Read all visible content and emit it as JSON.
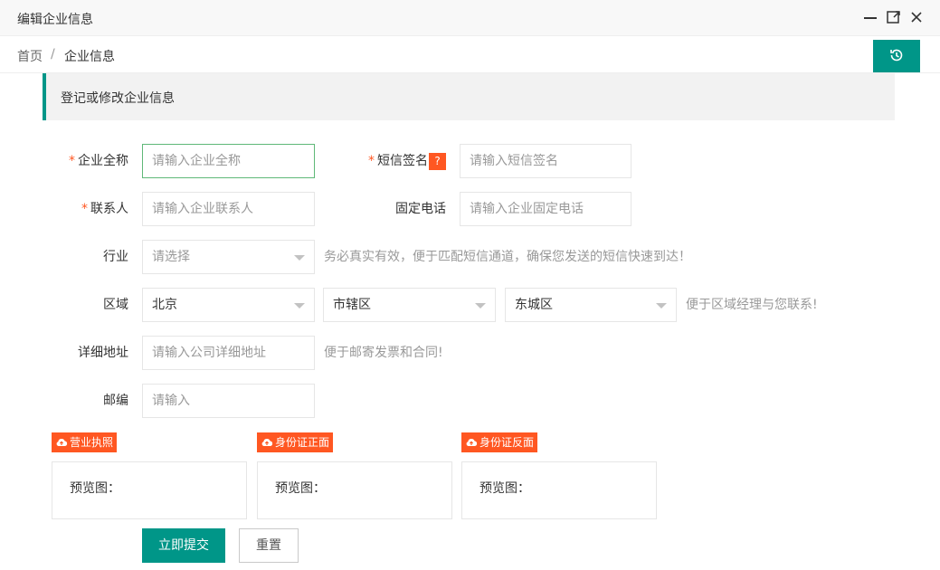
{
  "window": {
    "title": "编辑企业信息",
    "controls": [
      "minimize-icon",
      "maximize-icon",
      "close-icon"
    ]
  },
  "breadcrumb": {
    "home": "首页",
    "separator": "/",
    "current": "企业信息"
  },
  "history_button": {
    "icon": "history-icon"
  },
  "section": {
    "title": "登记或修改企业信息"
  },
  "form": {
    "company_name": {
      "required": "*",
      "label": "企业全称",
      "placeholder": "请输入企业全称",
      "value": ""
    },
    "sms_sign": {
      "required": "*",
      "label": "短信签名",
      "help": "?",
      "placeholder": "请输入短信签名",
      "value": ""
    },
    "contact": {
      "required": "*",
      "label": "联系人",
      "placeholder": "请输入企业联系人",
      "value": ""
    },
    "phone": {
      "label": "固定电话",
      "placeholder": "请输入企业固定电话",
      "value": ""
    },
    "industry": {
      "label": "行业",
      "selected": "请选择",
      "hint": "务必真实有效，便于匹配短信通道，确保您发送的短信快速到达！"
    },
    "region": {
      "label": "区域",
      "province": "北京",
      "city": "市辖区",
      "district": "东城区",
      "hint": "便于区域经理与您联系!"
    },
    "address": {
      "label": "详细地址",
      "placeholder": "请输入公司详细地址",
      "value": "",
      "hint": "便于邮寄发票和合同!"
    },
    "zipcode": {
      "label": "邮编",
      "placeholder": "请输入",
      "value": ""
    }
  },
  "uploads": [
    {
      "label": "营业执照",
      "preview_label": "预览图："
    },
    {
      "label": "身份证正面",
      "preview_label": "预览图："
    },
    {
      "label": "身份证反面",
      "preview_label": "预览图："
    }
  ],
  "actions": {
    "submit": "立即提交",
    "reset": "重置"
  },
  "colors": {
    "primary": "#009688",
    "danger": "#ff5722",
    "focus_border": "#5fb878"
  }
}
